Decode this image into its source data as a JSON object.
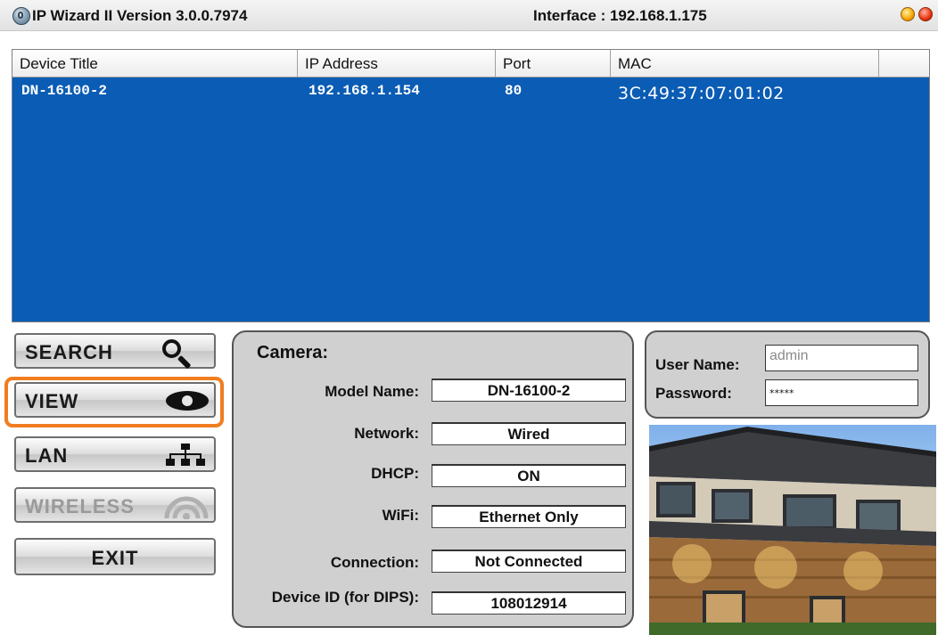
{
  "window": {
    "title": "IP Wizard II  Version 3.0.0.7974",
    "interface": "Interface : 192.168.1.175",
    "icon": "ip-wizard-app-icon",
    "controls": [
      "minimize-icon",
      "close-icon"
    ]
  },
  "device_table": {
    "columns": [
      "Device Title",
      "IP Address",
      "Port",
      "MAC"
    ],
    "rows": [
      {
        "title": "DN-16100-2",
        "ip": "192.168.1.154",
        "port": "80",
        "mac": "3C:49:37:07:01:02"
      }
    ],
    "selected_row": 0,
    "colors": {
      "selection": "#0a5cb4",
      "header": "#eeeeee"
    }
  },
  "nav": {
    "search": {
      "label": "SEARCH",
      "icon": "magnifier-icon"
    },
    "view": {
      "label": "VIEW",
      "icon": "eye-icon"
    },
    "lan": {
      "label": "LAN",
      "icon": "network-icon"
    },
    "wireless": {
      "label": "WIRELESS",
      "icon": "wifi-icon",
      "disabled": true
    },
    "exit": {
      "label": "EXIT"
    },
    "highlighted": "view",
    "highlight_color": "#f07d20"
  },
  "camera": {
    "heading": "Camera:",
    "fields": {
      "model_name": {
        "label": "Model Name:",
        "value": "DN-16100-2"
      },
      "network": {
        "label": "Network:",
        "value": "Wired"
      },
      "dhcp": {
        "label": "DHCP:",
        "value": "ON"
      },
      "wifi": {
        "label": "WiFi:",
        "value": "Ethernet Only"
      },
      "connection": {
        "label": "Connection:",
        "value": "Not Connected"
      },
      "device_id": {
        "label": "Device ID (for DIPS):",
        "value": "108012914"
      }
    }
  },
  "login": {
    "user_label": "User Name:",
    "user_value": "admin",
    "pass_label": "Password:",
    "pass_value": "*****"
  },
  "preview": {
    "subject": "house-exterior-photo"
  }
}
